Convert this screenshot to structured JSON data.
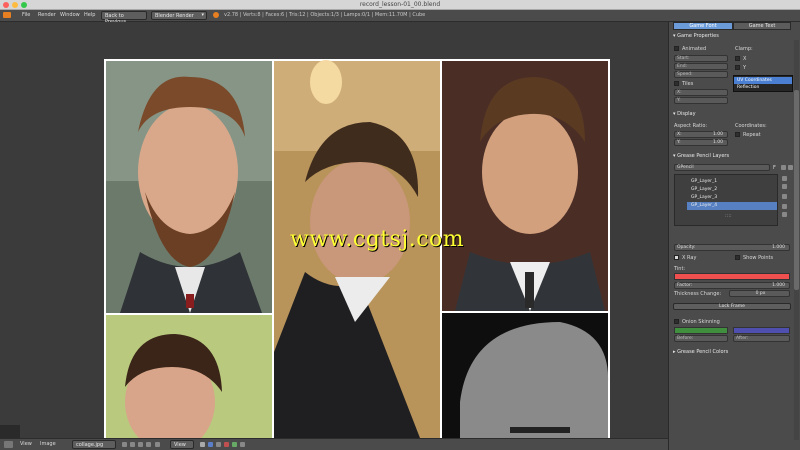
{
  "window": {
    "title": "record_lesson-01_00.blend"
  },
  "infobar": {
    "menus": [
      "File",
      "Render",
      "Window",
      "Help"
    ],
    "back_button": "Back to Previous",
    "engine": "Blender Render",
    "stats": "v2.78 | Verts:8 | Faces:6 | Tris:12 | Objects:1/3 | Lamps:0/1 | Mem:11.70M | Cube"
  },
  "watermark": "www.cgtsj.com",
  "bottombar": {
    "view": "View",
    "image": "Image",
    "image_name": "collage.jpg",
    "view2": "View"
  },
  "props": {
    "tabs": [
      "Game Font",
      "Game Text"
    ],
    "game_properties": {
      "header": "Game Properties",
      "animated": "Animated",
      "clamp": "Clamp:",
      "start": "Start:",
      "end": "End:",
      "speed": "Speed:",
      "x": "X",
      "y": "Y",
      "tiles": "Tiles",
      "tx": "X:",
      "ty": "Y:",
      "dropdown_opt1": "UV Coordinates",
      "dropdown_opt2": "Reflection"
    },
    "display": {
      "header": "Display",
      "aspect": "Aspect Ratio:",
      "coordinates": "Coordinates:",
      "ax": "X:",
      "ax_val": "1.00",
      "ay": "Y:",
      "ay_val": "1.00",
      "repeat": "Repeat"
    },
    "grease": {
      "header": "Grease Pencil Layers",
      "gpencil": "GPencil",
      "f_label": "F",
      "layers": [
        "GP_Layer_1",
        "GP_Layer_2",
        "GP_Layer_3",
        "GP_Layer_4"
      ],
      "active_index": 3,
      "opacity": "Opacity:",
      "opacity_val": "1.000",
      "xray": "X Ray",
      "show_points": "Show Points",
      "tint": "Tint:",
      "factor": "Factor:",
      "factor_val": "1.000",
      "thickness": "Thickness Change:",
      "thickness_val": "0 px",
      "lock_frame": "Lock Frame",
      "onion": "Onion Skinning",
      "before": "Before:",
      "after": "After:",
      "colors": "Grease Pencil Colors"
    }
  },
  "colors": {
    "tint": "#ef4f4f",
    "onion_before": "#3f8f3f",
    "onion_after": "#4f4faf",
    "active_layer": "#5680c2",
    "dropdown_active": "#4a7fd1"
  }
}
